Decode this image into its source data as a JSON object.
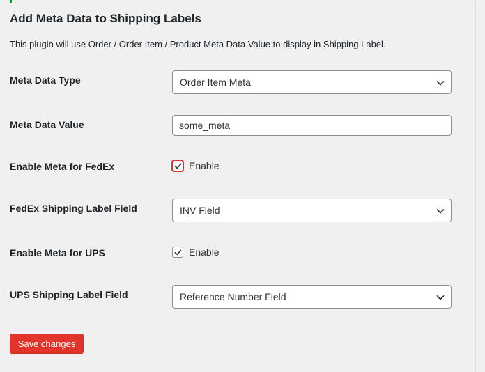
{
  "page": {
    "title": "Add Meta Data to Shipping Labels",
    "description": "This plugin will use Order / Order Item / Product Meta Data Value to display in Shipping Label."
  },
  "fields": {
    "meta_type": {
      "label": "Meta Data Type",
      "value": "Order Item Meta"
    },
    "meta_value": {
      "label": "Meta Data Value",
      "value": "some_meta"
    },
    "fedex_enable": {
      "label": "Enable Meta for FedEx",
      "checkbox_label": "Enable",
      "checked": true
    },
    "fedex_field": {
      "label": "FedEx Shipping Label Field",
      "value": "INV Field"
    },
    "ups_enable": {
      "label": "Enable Meta for UPS",
      "checkbox_label": "Enable",
      "checked": true
    },
    "ups_field": {
      "label": "UPS Shipping Label Field",
      "value": "Reference Number Field"
    }
  },
  "actions": {
    "save_label": "Save changes"
  },
  "colors": {
    "page_bg": "#f0f0f1",
    "accent_green": "#00a32a",
    "save_button": "#e0342c",
    "focus_outline": "#d63638",
    "text": "#1d2327"
  },
  "icons": {
    "select_arrow": "chevron-down-icon",
    "checkmark": "checkmark-icon"
  }
}
